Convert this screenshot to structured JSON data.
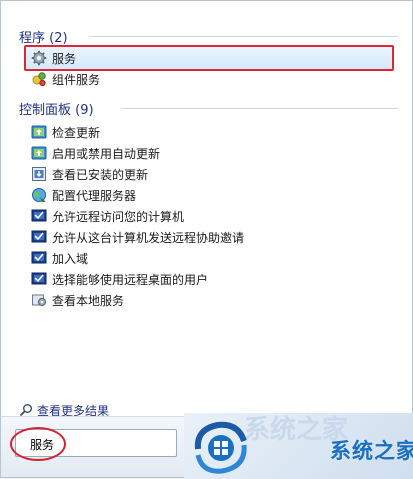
{
  "programs": {
    "header": "程序 (2)",
    "items": [
      {
        "label": "服务",
        "icon": "gear-services-icon"
      },
      {
        "label": "组件服务",
        "icon": "component-services-icon"
      }
    ]
  },
  "control_panel": {
    "header": "控制面板 (9)",
    "items": [
      {
        "label": "检查更新",
        "icon": "windows-update-icon"
      },
      {
        "label": "启用或禁用自动更新",
        "icon": "windows-update-icon"
      },
      {
        "label": "查看已安装的更新",
        "icon": "installed-updates-icon"
      },
      {
        "label": "配置代理服务器",
        "icon": "internet-options-icon"
      },
      {
        "label": "允许远程访问您的计算机",
        "icon": "system-shield-icon"
      },
      {
        "label": "允许从这台计算机发送远程协助邀请",
        "icon": "system-shield-icon"
      },
      {
        "label": "加入域",
        "icon": "system-shield-icon"
      },
      {
        "label": "选择能够使用远程桌面的用户",
        "icon": "system-shield-icon"
      },
      {
        "label": "查看本地服务",
        "icon": "admin-tools-icon"
      }
    ]
  },
  "more_results": {
    "label": "查看更多结果",
    "icon": "search-icon"
  },
  "search": {
    "value": "服务"
  },
  "watermark": {
    "text": "系统之家"
  },
  "colors": {
    "header": "#1e3287",
    "highlight_border": "#e02535",
    "annotation": "#d9222f",
    "watermark": "#1a6fc2"
  }
}
